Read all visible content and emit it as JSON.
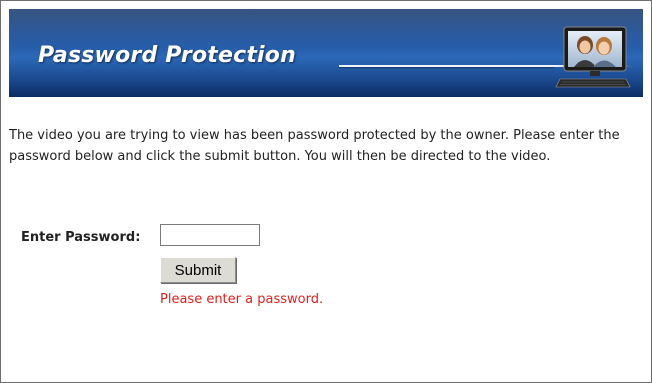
{
  "banner": {
    "title": "Password Protection",
    "graphic": "monitor-with-video-chat-icon"
  },
  "intro_text": "The video you are trying to view has been password protected by the owner. Please enter the password below and click the submit button. You will then be directed to the video.",
  "form": {
    "password_label": "Enter Password:",
    "password_value": "",
    "submit_label": "Submit",
    "error_message": "Please enter a password."
  },
  "colors": {
    "banner_blue": "#1c4e97",
    "error_red": "#e01f1f"
  }
}
